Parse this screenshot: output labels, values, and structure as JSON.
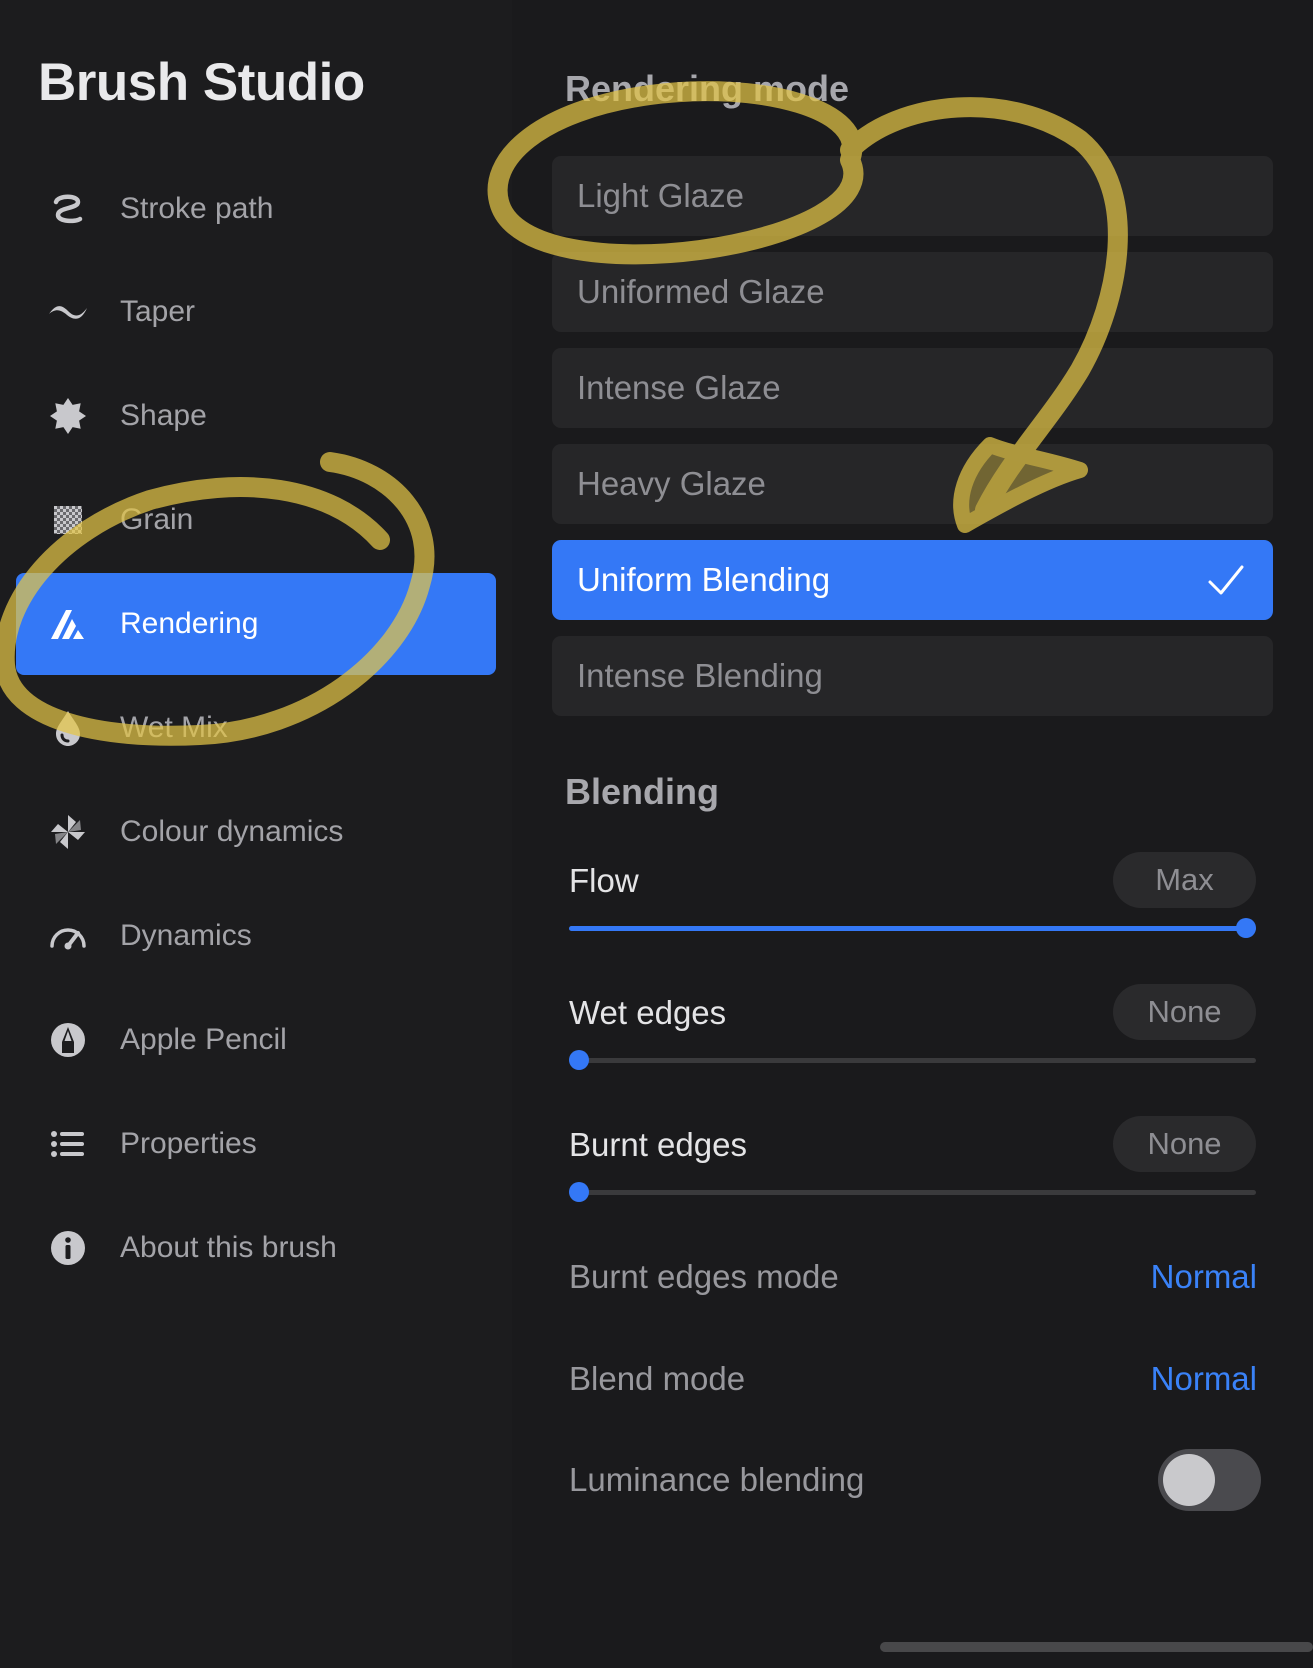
{
  "app": {
    "title": "Brush Studio"
  },
  "sidebar": {
    "items": [
      {
        "label": "Stroke path",
        "icon": "stroke-path-icon",
        "active": false
      },
      {
        "label": "Taper",
        "icon": "taper-icon",
        "active": false
      },
      {
        "label": "Shape",
        "icon": "shape-icon",
        "active": false
      },
      {
        "label": "Grain",
        "icon": "grain-icon",
        "active": false
      },
      {
        "label": "Rendering",
        "icon": "rendering-icon",
        "active": true
      },
      {
        "label": "Wet Mix",
        "icon": "wet-mix-icon",
        "active": false
      },
      {
        "label": "Colour dynamics",
        "icon": "colour-dynamics-icon",
        "active": false
      },
      {
        "label": "Dynamics",
        "icon": "dynamics-icon",
        "active": false
      },
      {
        "label": "Apple Pencil",
        "icon": "apple-pencil-icon",
        "active": false
      },
      {
        "label": "Properties",
        "icon": "properties-icon",
        "active": false
      },
      {
        "label": "About this brush",
        "icon": "info-icon",
        "active": false
      }
    ]
  },
  "rendering_mode": {
    "heading": "Rendering mode",
    "options": [
      {
        "label": "Light Glaze",
        "selected": false
      },
      {
        "label": "Uniformed Glaze",
        "selected": false
      },
      {
        "label": "Intense Glaze",
        "selected": false
      },
      {
        "label": "Heavy Glaze",
        "selected": false
      },
      {
        "label": "Uniform Blending",
        "selected": true
      },
      {
        "label": "Intense Blending",
        "selected": false
      }
    ]
  },
  "blending": {
    "heading": "Blending",
    "sliders": [
      {
        "label": "Flow",
        "value": "Max",
        "level": 1.0
      },
      {
        "label": "Wet edges",
        "value": "None",
        "level": 0.0
      },
      {
        "label": "Burnt edges",
        "value": "None",
        "level": 0.0
      }
    ],
    "burnt_edges_mode": {
      "label": "Burnt edges mode",
      "value": "Normal"
    },
    "blend_mode": {
      "label": "Blend mode",
      "value": "Normal"
    },
    "luminance_blending": {
      "label": "Luminance blending",
      "on": false
    }
  },
  "colors": {
    "accent": "#3478f6",
    "background": "#1c1c1e",
    "option_background": "#262628",
    "annotation": "#e3c546"
  }
}
